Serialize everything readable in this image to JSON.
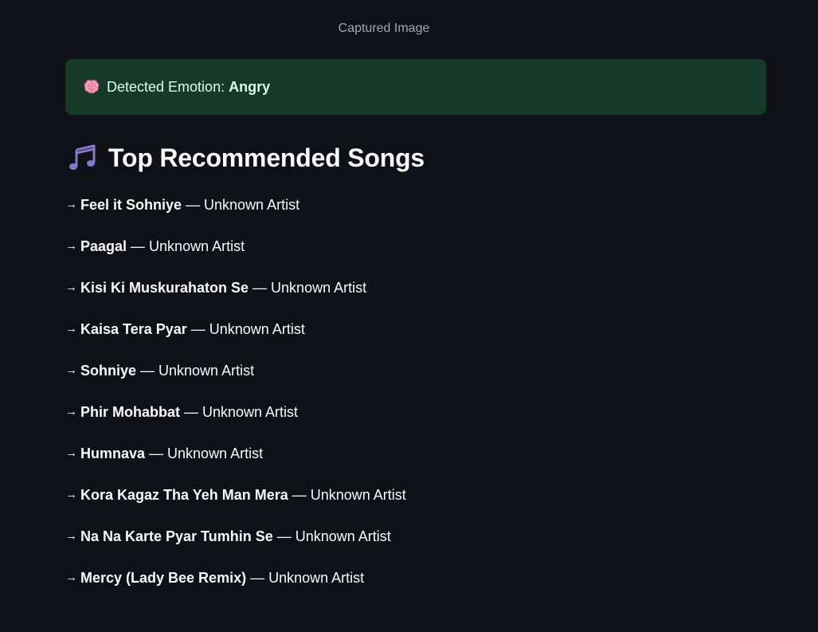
{
  "image_caption": "Captured Image",
  "emotion_alert": {
    "icon": "brain-icon",
    "label": "Detected Emotion:",
    "value": "Angry",
    "background": "#173928",
    "text_color": "#dffde9"
  },
  "recommendations": {
    "icon": "music-notes-icon",
    "heading": "Top Recommended Songs",
    "separator": "—",
    "songs": [
      {
        "title": "Feel it Sohniye",
        "artist": "Unknown Artist"
      },
      {
        "title": "Paagal",
        "artist": "Unknown Artist"
      },
      {
        "title": "Kisi Ki Muskurahaton Se",
        "artist": "Unknown Artist"
      },
      {
        "title": "Kaisa Tera Pyar",
        "artist": "Unknown Artist"
      },
      {
        "title": "Sohniye",
        "artist": "Unknown Artist"
      },
      {
        "title": "Phir Mohabbat",
        "artist": "Unknown Artist"
      },
      {
        "title": "Humnava",
        "artist": "Unknown Artist"
      },
      {
        "title": "Kora Kagaz Tha Yeh Man Mera",
        "artist": "Unknown Artist"
      },
      {
        "title": "Na Na Karte Pyar Tumhin Se",
        "artist": "Unknown Artist"
      },
      {
        "title": "Mercy (Lady Bee Remix)",
        "artist": "Unknown Artist"
      }
    ]
  },
  "colors": {
    "page_background": "#0e1117",
    "text": "#fafafa",
    "caption_text": "#a3a8b4"
  }
}
